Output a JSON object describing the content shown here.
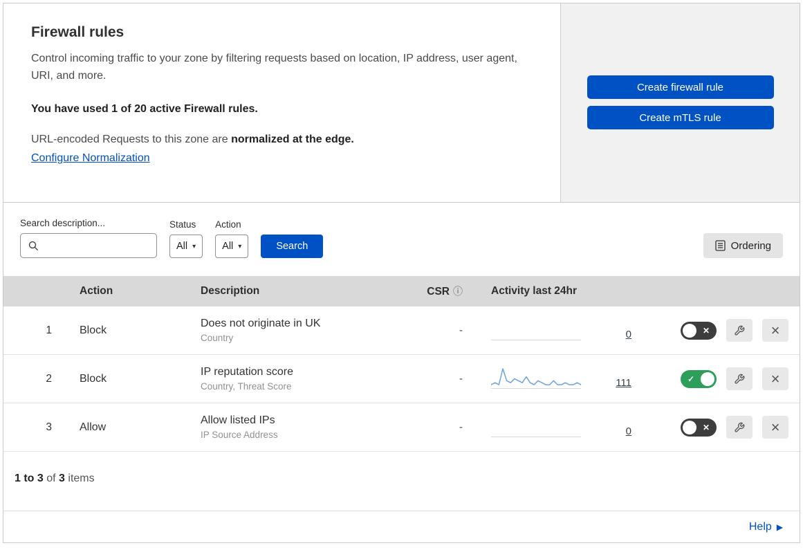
{
  "colors": {
    "accent_blue": "#0051c3",
    "toggle_on_green": "#2e9e5b",
    "toggle_off_gray": "#3d3d3d",
    "sparkline": "#6ba3dc"
  },
  "header": {
    "title": "Firewall rules",
    "description": "Control incoming traffic to your zone by filtering requests based on location, IP address, user agent, URI, and more.",
    "usage": "You have used 1 of 20 active Firewall rules.",
    "normalization_prefix": "URL-encoded Requests to this zone are ",
    "normalization_bold": "normalized at the edge.",
    "normalization_link": "Configure Normalization",
    "create_firewall_button": "Create firewall rule",
    "create_mtls_button": "Create mTLS rule"
  },
  "filters": {
    "search_label": "Search description...",
    "search_placeholder": "",
    "status_label": "Status",
    "status_value": "All",
    "action_label": "Action",
    "action_value": "All",
    "search_button": "Search",
    "ordering_button": "Ordering"
  },
  "table": {
    "headers": {
      "action": "Action",
      "description": "Description",
      "csr": "CSR",
      "csr_info_icon": "ⓘ",
      "activity": "Activity last 24hr"
    },
    "rows": [
      {
        "index": "1",
        "action": "Block",
        "description": "Does not originate in UK",
        "match_fields": "Country",
        "csr": "-",
        "activity_count": "0",
        "enabled": false,
        "sparkline": []
      },
      {
        "index": "2",
        "action": "Block",
        "description": "IP reputation score",
        "match_fields": "Country, Threat Score",
        "csr": "-",
        "activity_count": "111",
        "enabled": true,
        "sparkline": [
          1,
          2,
          1,
          9,
          3,
          2,
          4,
          3,
          2,
          5,
          2,
          1,
          3,
          2,
          1,
          1,
          3,
          1,
          1,
          2,
          1,
          1,
          2,
          1
        ]
      },
      {
        "index": "3",
        "action": "Allow",
        "description": "Allow listed IPs",
        "match_fields": "IP Source Address",
        "csr": "-",
        "activity_count": "0",
        "enabled": false,
        "sparkline": []
      }
    ]
  },
  "footer": {
    "range": "1 to 3",
    "of": " of ",
    "total": "3",
    "items": " items"
  },
  "help": {
    "label": "Help"
  }
}
